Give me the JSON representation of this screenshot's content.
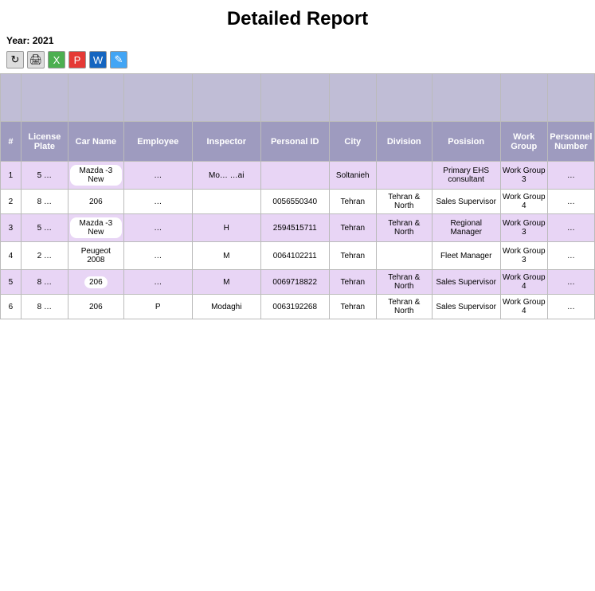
{
  "title": "Detailed Report",
  "year_label": "Year: 2021",
  "toolbar": {
    "icons": [
      {
        "name": "refresh-icon",
        "symbol": "↻",
        "class": "refresh"
      },
      {
        "name": "print-icon",
        "symbol": "🖨",
        "class": "print"
      },
      {
        "name": "excel-icon",
        "symbol": "X",
        "class": "excel"
      },
      {
        "name": "pdf-icon",
        "symbol": "P",
        "class": "pdf"
      },
      {
        "name": "word-icon",
        "symbol": "W",
        "class": "word"
      },
      {
        "name": "edit-icon",
        "symbol": "✎",
        "class": "edit"
      }
    ]
  },
  "columns": [
    {
      "key": "num",
      "label": "#",
      "class": "col-num"
    },
    {
      "key": "license_plate",
      "label": "License Plate",
      "class": "col-license"
    },
    {
      "key": "car_name",
      "label": "Car Name",
      "class": "col-car"
    },
    {
      "key": "employee",
      "label": "Employee",
      "class": "col-employee"
    },
    {
      "key": "inspector",
      "label": "Inspector",
      "class": "col-inspector"
    },
    {
      "key": "personal_id",
      "label": "Personal ID",
      "class": "col-personal"
    },
    {
      "key": "city",
      "label": "City",
      "class": "col-city"
    },
    {
      "key": "division",
      "label": "Division",
      "class": "col-division"
    },
    {
      "key": "position",
      "label": "Posision",
      "class": "col-position"
    },
    {
      "key": "work_group",
      "label": "Work Group",
      "class": "col-workgroup"
    },
    {
      "key": "personnel_number",
      "label": "Personnel Number",
      "class": "col-personnel"
    }
  ],
  "rows": [
    {
      "num": "1",
      "license_plate": "5\n…",
      "car_name": "Mazda -3 New",
      "employee": "…",
      "inspector": "Mo… …ai",
      "personal_id": "",
      "city": "Soltanieh",
      "division": "",
      "position": "Primary EHS consultant",
      "work_group": "Work Group 3",
      "personnel_number": "…",
      "style": "row-purple"
    },
    {
      "num": "2",
      "license_plate": "8\n…",
      "car_name": "206",
      "employee": "…",
      "inspector": "",
      "personal_id": "0056550340",
      "city": "Tehran",
      "division": "Tehran & North",
      "position": "Sales Supervisor",
      "work_group": "Work Group 4",
      "personnel_number": "…",
      "style": "row-white"
    },
    {
      "num": "3",
      "license_plate": "5\n…",
      "car_name": "Mazda -3 New",
      "employee": "…",
      "inspector": "H",
      "personal_id": "2594515711",
      "city": "Tehran",
      "division": "Tehran & North",
      "position": "Regional Manager",
      "work_group": "Work Group 3",
      "personnel_number": "…",
      "style": "row-purple"
    },
    {
      "num": "4",
      "license_plate": "2\n…",
      "car_name": "Peugeot 2008",
      "employee": "…",
      "inspector": "M",
      "personal_id": "0064102211",
      "city": "Tehran",
      "division": "",
      "position": "Fleet Manager",
      "work_group": "Work Group 3",
      "personnel_number": "…",
      "style": "row-white"
    },
    {
      "num": "5",
      "license_plate": "8\n…",
      "car_name": "206",
      "employee": "…",
      "inspector": "M",
      "personal_id": "0069718822",
      "city": "Tehran",
      "division": "Tehran & North",
      "position": "Sales Supervisor",
      "work_group": "Work Group 4",
      "personnel_number": "…",
      "style": "row-purple"
    },
    {
      "num": "6",
      "license_plate": "8\n…",
      "car_name": "206",
      "employee": "P",
      "inspector": "Modaghi",
      "personal_id": "0063192268",
      "city": "Tehran",
      "division": "Tehran & North",
      "position": "Sales Supervisor",
      "work_group": "Work Group 4",
      "personnel_number": "…",
      "style": "row-white"
    }
  ]
}
